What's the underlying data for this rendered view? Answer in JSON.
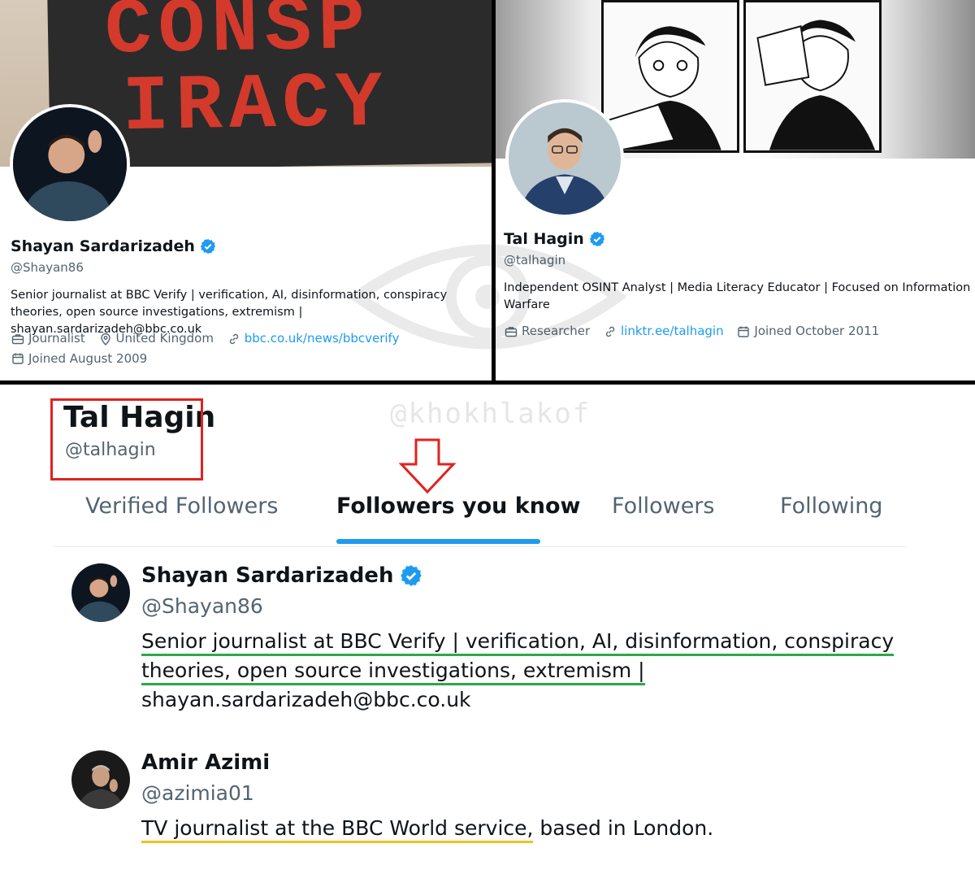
{
  "left_profile": {
    "banner_text_line1": "CONSP",
    "banner_text_line2": "IRACY",
    "name": "Shayan Sardarizadeh",
    "handle": "@Shayan86",
    "bio_line1": "Senior journalist at BBC Verify | verification, AI, disinformation, conspiracy",
    "bio_line2": "theories, open source investigations, extremism | shayan.sardarizadeh@bbc.co.uk",
    "profession": "Journalist",
    "location": "United Kingdom",
    "website": "bbc.co.uk/news/bbcverify",
    "joined": "Joined August 2009"
  },
  "right_profile": {
    "name": "Tal Hagin",
    "handle": "@talhagin",
    "bio_line1": "Independent OSINT Analyst | Media Literacy Educator | Focused on Information",
    "bio_line2": "Warfare",
    "profession": "Researcher",
    "website": "linktr.ee/talhagin",
    "joined": "Joined October 2011"
  },
  "bottom": {
    "watermark": "@khokhlakof",
    "title_name": "Tal Hagin",
    "title_handle": "@talhagin",
    "tabs": [
      {
        "label": "Verified Followers",
        "active": false
      },
      {
        "label": "Followers you know",
        "active": true
      },
      {
        "label": "Followers",
        "active": false
      },
      {
        "label": "Following",
        "active": false
      }
    ],
    "users": [
      {
        "name": "Shayan Sardarizadeh",
        "handle": "@Shayan86",
        "verified": true,
        "bio_hl1": "Senior journalist at BBC Verify | verification, AI, disinformation, conspiracy",
        "bio_hl2": "theories, open source investigations, extremism |",
        "bio_rest": "shayan.sardarizadeh@bbc.co.uk"
      },
      {
        "name": "Amir Azimi",
        "handle": "@azimia01",
        "verified": false,
        "bio_hl": "TV journalist at the BBC World service,",
        "bio_rest": " based in London."
      }
    ]
  },
  "colors": {
    "accent": "#1d9bf0",
    "highlight_box": "#e0231f",
    "underline_green": "#2ea84a",
    "underline_yellow": "#f2c21b"
  }
}
